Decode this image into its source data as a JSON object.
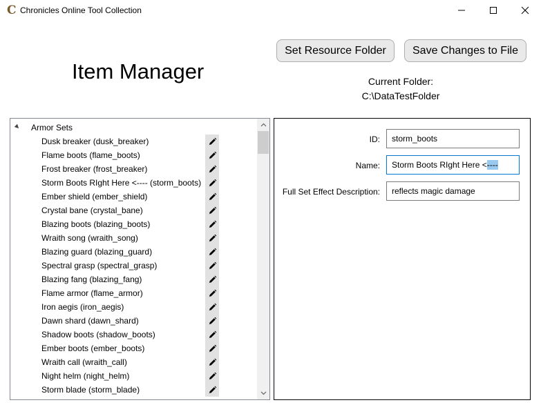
{
  "window": {
    "title": "Chronicles Online Tool Collection",
    "app_icon_glyph": "C"
  },
  "toolbar": {
    "set_resource_label": "Set Resource Folder",
    "save_label": "Save Changes to File"
  },
  "page_title": "Item Manager",
  "folder": {
    "label": "Current Folder:",
    "path": "C:\\DataTestFolder"
  },
  "tree": {
    "root_label": "Armor Sets",
    "edit_icon": "pencil-icon",
    "items": [
      "Dusk breaker (dusk_breaker)",
      "Flame boots (flame_boots)",
      "Frost breaker (frost_breaker)",
      "Storm Boots RIght Here <---- (storm_boots)",
      "Ember shield (ember_shield)",
      "Crystal bane (crystal_bane)",
      "Blazing boots (blazing_boots)",
      "Wraith song (wraith_song)",
      "Blazing guard (blazing_guard)",
      "Spectral grasp (spectral_grasp)",
      "Blazing fang (blazing_fang)",
      "Flame armor (flame_armor)",
      "Iron aegis (iron_aegis)",
      "Dawn shard (dawn_shard)",
      "Shadow boots (shadow_boots)",
      "Ember boots (ember_boots)",
      "Wraith call (wraith_call)",
      "Night helm (night_helm)",
      "Storm blade (storm_blade)"
    ]
  },
  "detail": {
    "id_label": "ID:",
    "id_value": "storm_boots",
    "name_label": "Name:",
    "name_value_plain": "Storm Boots RIght Here <",
    "name_value_selected": "----",
    "effect_label": "Full Set Effect Description:",
    "effect_value": "reflects magic damage"
  },
  "colors": {
    "accent": "#0078d7",
    "selection": "#99c9ef",
    "button_bg": "#e9e9e9",
    "edit_bg": "#e1e1e1"
  }
}
